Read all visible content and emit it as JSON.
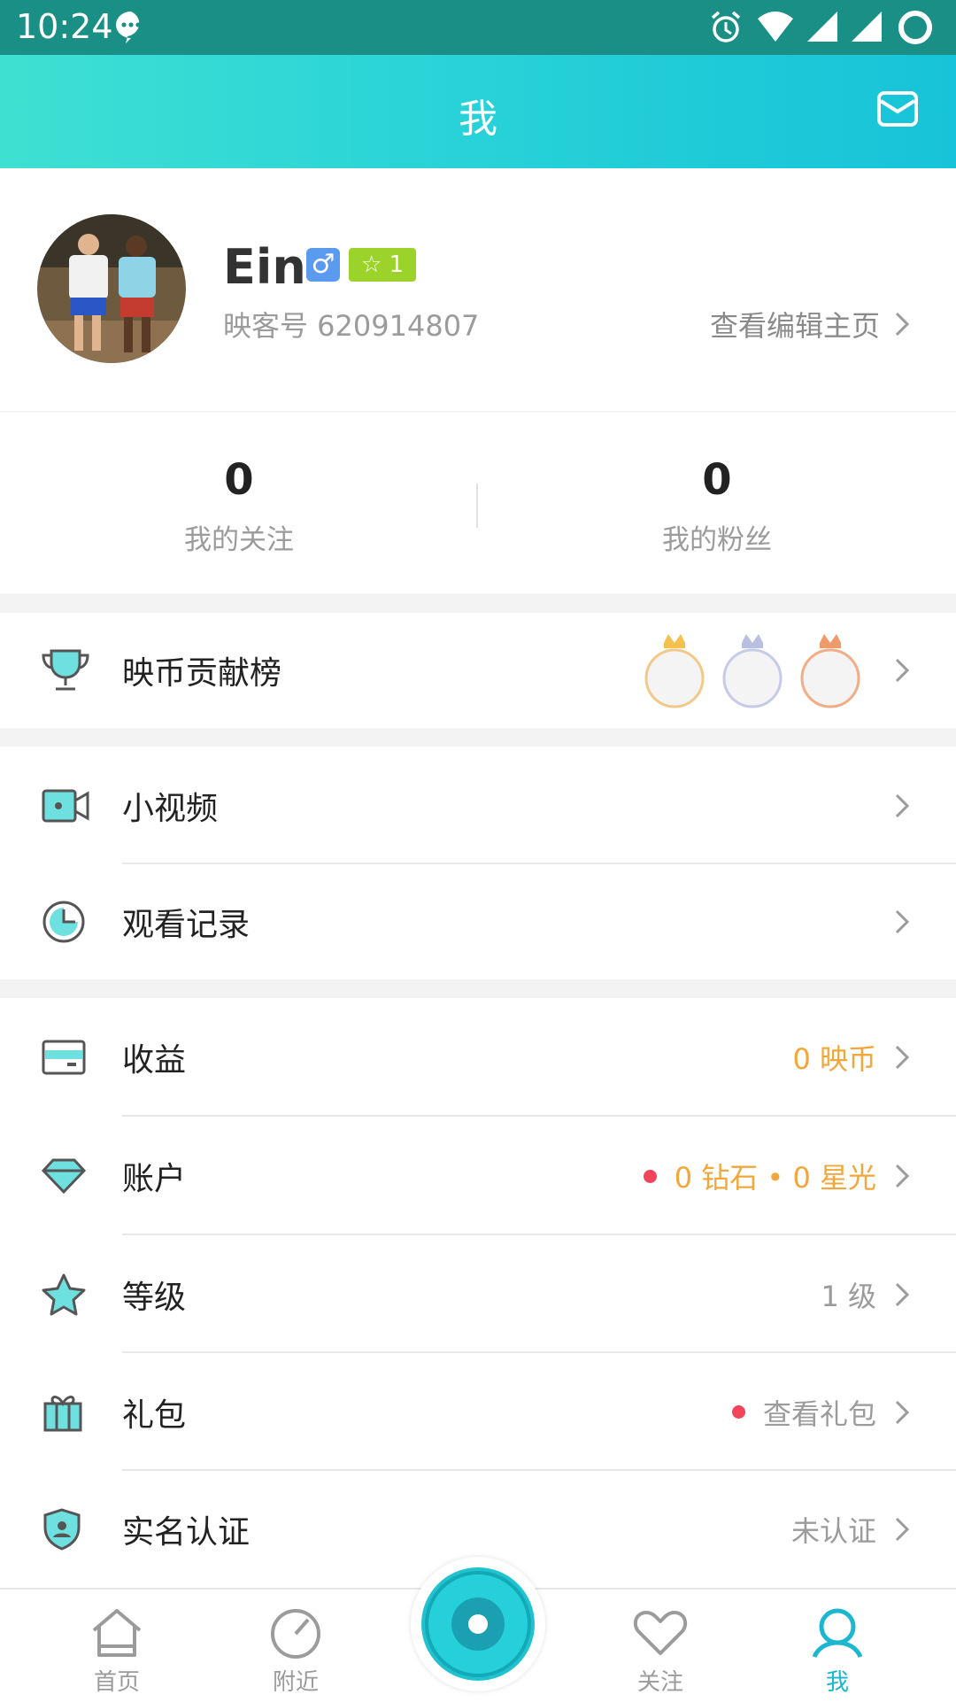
{
  "status_bar": {
    "time": "10:24"
  },
  "header": {
    "title": "我"
  },
  "profile": {
    "name": "Ein",
    "gender_symbol": "♂",
    "level_badge": "☆ 1",
    "id_text": "映客号 620914807",
    "view_edit_label": "查看编辑主页"
  },
  "stats": [
    {
      "value": "0",
      "label": "我的关注"
    },
    {
      "value": "0",
      "label": "我的粉丝"
    }
  ],
  "menu": {
    "contribution": {
      "label": "映币贡献榜"
    },
    "short_video": {
      "label": "小视频"
    },
    "history": {
      "label": "观看记录"
    },
    "income": {
      "label": "收益",
      "value": "0 映币"
    },
    "account": {
      "label": "账户",
      "value": "0 钻石 • 0 星光"
    },
    "level": {
      "label": "等级",
      "value": "1 级"
    },
    "gift": {
      "label": "礼包",
      "value": "查看礼包"
    },
    "verify": {
      "label": "实名认证",
      "value": "未认证"
    }
  },
  "tabs": [
    {
      "label": "首页",
      "icon": "home-icon"
    },
    {
      "label": "附近",
      "icon": "compass-icon"
    },
    {
      "label": "关注",
      "icon": "heart-icon"
    },
    {
      "label": "我",
      "icon": "user-icon"
    }
  ],
  "colors": {
    "accent": "#27d2d8",
    "orange_value": "#f2a73c",
    "red_dot": "#f2445a",
    "gender_badge": "#5b9bef",
    "level_badge": "#9cd32a"
  }
}
